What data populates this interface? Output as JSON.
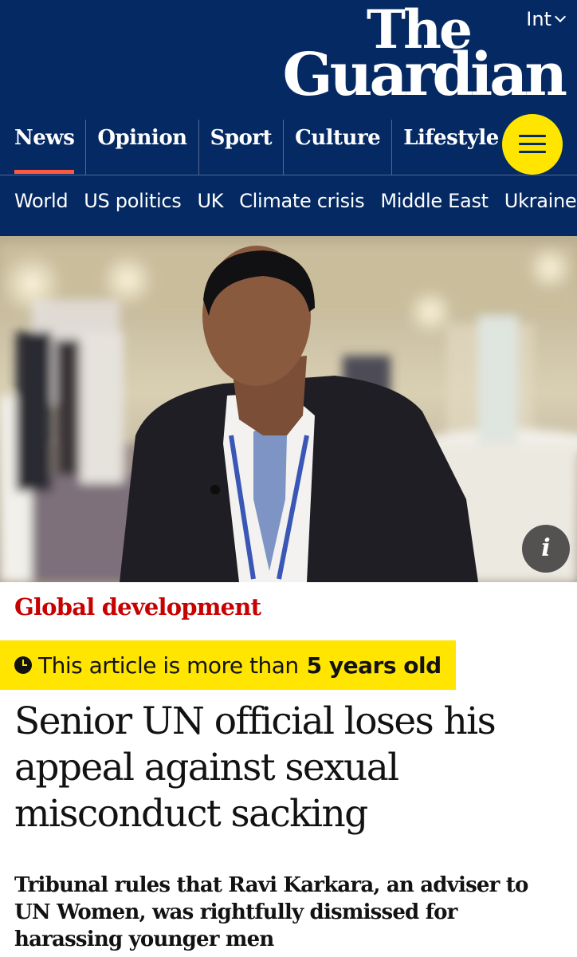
{
  "header": {
    "edition_label": "Int",
    "logo_line1": "The",
    "logo_line2": "Guardian",
    "background_color": "#052962",
    "pillars": [
      {
        "label": "News",
        "active": true
      },
      {
        "label": "Opinion",
        "active": false
      },
      {
        "label": "Sport",
        "active": false
      },
      {
        "label": "Culture",
        "active": false
      },
      {
        "label": "Lifestyle",
        "active": false
      }
    ],
    "menu_icon": "hamburger-menu-icon",
    "menu_color": "#ffe500",
    "active_indicator_color": "#ff5943"
  },
  "subnav": {
    "items": [
      "World",
      "US politics",
      "UK",
      "Climate crisis",
      "Middle East",
      "Ukraine"
    ]
  },
  "media": {
    "info_button_label": "i",
    "info_icon": "info-icon"
  },
  "article": {
    "section": "Global development",
    "section_color": "#c70000",
    "age_warning": {
      "icon": "clock-icon",
      "prefix": "This article is more than",
      "emphasis": "5 years old",
      "background": "#ffe500"
    },
    "headline": "Senior UN official loses his appeal against sexual misconduct sacking",
    "standfirst": "Tribunal rules that Ravi Karkara, an adviser to UN Women, was rightfully dismissed for harassing younger men"
  }
}
